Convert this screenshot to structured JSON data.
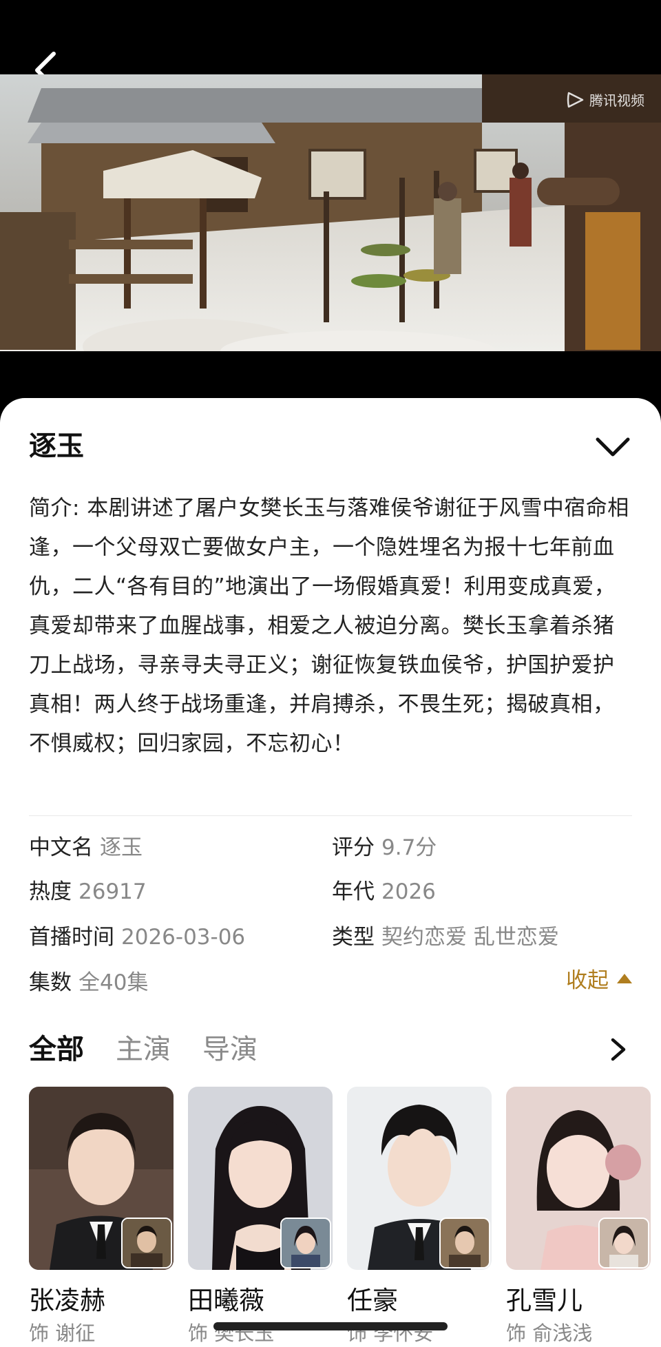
{
  "video": {
    "watermark": "腾讯视频"
  },
  "detail": {
    "title": "逐玉",
    "synopsis": "简介: 本剧讲述了屠户女樊长玉与落难侯爷谢征于风雪中宿命相逢，一个父母双亡要做女户主，一个隐姓埋名为报十七年前血仇，二人“各有目的”地演出了一场假婚真爱！利用变成真爱，真爱却带来了血腥战事，相爱之人被迫分离。樊长玉拿着杀猪刀上战场，寻亲寻夫寻正义；谢征恢复铁血侯爷，护国护爱护真相！两人终于战场重逢，并肩搏杀，不畏生死；揭破真相，不惧威权；回归家园，不忘初心！",
    "info": {
      "cn_name_label": "中文名",
      "cn_name_value": "逐玉",
      "score_label": "评分",
      "score_value": "9.7分",
      "heat_label": "热度",
      "heat_value": "26917",
      "year_label": "年代",
      "year_value": "2026",
      "premiere_label": "首播时间",
      "premiere_value": "2026-03-06",
      "genre_label": "类型",
      "genre_value": "契约恋爱 乱世恋爱",
      "episodes_label": "集数",
      "episodes_value": "全40集"
    },
    "collapse_label": "收起"
  },
  "tabs": [
    {
      "label": "全部",
      "active": true
    },
    {
      "label": "主演",
      "active": false
    },
    {
      "label": "导演",
      "active": false
    }
  ],
  "cast": [
    {
      "name": "张凌赫",
      "role": "饰 谢征"
    },
    {
      "name": "田曦薇",
      "role": "饰 樊长玉"
    },
    {
      "name": "任豪",
      "role": "饰 李怀安"
    },
    {
      "name": "孔雪儿",
      "role": "饰 俞浅浅"
    }
  ],
  "colors": {
    "accent": "#b07e1f",
    "sheet_bg": "#ffffff",
    "top_bg": "#000000"
  }
}
